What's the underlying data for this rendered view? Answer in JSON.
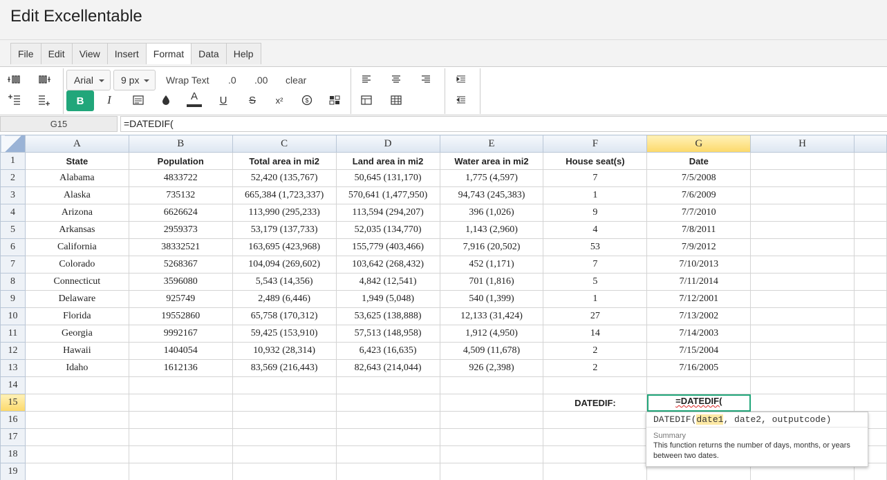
{
  "app": {
    "title": "Edit Excellentable"
  },
  "menu": [
    "File",
    "Edit",
    "View",
    "Insert",
    "Format",
    "Data",
    "Help"
  ],
  "menu_active": "Format",
  "toolbar": {
    "font_family": "Arial",
    "font_size": "9 px",
    "wrap_text": "Wrap Text",
    "dec_decrease": ".0",
    "dec_increase": ".00",
    "clear": "clear",
    "bold": "B",
    "italic": "I",
    "underline": "U",
    "strike": "S",
    "superscript": "x²",
    "font_color": "A",
    "accent_color": "#21a67a"
  },
  "formula_bar": {
    "cell_ref": "G15",
    "formula": "=DATEDIF("
  },
  "sheet": {
    "columns": [
      "A",
      "B",
      "C",
      "D",
      "E",
      "F",
      "G",
      "H"
    ],
    "rows": [
      "1",
      "2",
      "3",
      "4",
      "5",
      "6",
      "7",
      "8",
      "9",
      "10",
      "11",
      "12",
      "13",
      "14",
      "15",
      "16",
      "17",
      "18",
      "19"
    ],
    "header_row": [
      "State",
      "Population",
      "Total area in mi2",
      "Land area in mi2",
      "Water area in mi2",
      "House seat(s)",
      "Date",
      ""
    ],
    "data_rows": [
      [
        "Alabama",
        "4833722",
        "52,420 (135,767)",
        "50,645 (131,170)",
        "1,775 (4,597)",
        "7",
        "7/5/2008",
        ""
      ],
      [
        "Alaska",
        "735132",
        "665,384 (1,723,337)",
        "570,641 (1,477,950)",
        "94,743 (245,383)",
        "1",
        "7/6/2009",
        ""
      ],
      [
        "Arizona",
        "6626624",
        "113,990 (295,233)",
        "113,594 (294,207)",
        "396 (1,026)",
        "9",
        "7/7/2010",
        ""
      ],
      [
        "Arkansas",
        "2959373",
        "53,179 (137,733)",
        "52,035 (134,770)",
        "1,143 (2,960)",
        "4",
        "7/8/2011",
        ""
      ],
      [
        "California",
        "38332521",
        "163,695 (423,968)",
        "155,779 (403,466)",
        "7,916 (20,502)",
        "53",
        "7/9/2012",
        ""
      ],
      [
        "Colorado",
        "5268367",
        "104,094 (269,602)",
        "103,642 (268,432)",
        "452 (1,171)",
        "7",
        "7/10/2013",
        ""
      ],
      [
        "Connecticut",
        "3596080",
        "5,543 (14,356)",
        "4,842 (12,541)",
        "701 (1,816)",
        "5",
        "7/11/2014",
        ""
      ],
      [
        "Delaware",
        "925749",
        "2,489 (6,446)",
        "1,949 (5,048)",
        "540 (1,399)",
        "1",
        "7/12/2001",
        ""
      ],
      [
        "Florida",
        "19552860",
        "65,758 (170,312)",
        "53,625 (138,888)",
        "12,133 (31,424)",
        "27",
        "7/13/2002",
        ""
      ],
      [
        "Georgia",
        "9992167",
        "59,425 (153,910)",
        "57,513 (148,958)",
        "1,912 (4,950)",
        "14",
        "7/14/2003",
        ""
      ],
      [
        "Hawaii",
        "1404054",
        "10,932 (28,314)",
        "6,423 (16,635)",
        "4,509 (11,678)",
        "2",
        "7/15/2004",
        ""
      ],
      [
        "Idaho",
        "1612136",
        "83,569 (216,443)",
        "82,643 (214,044)",
        "926 (2,398)",
        "2",
        "7/16/2005",
        ""
      ]
    ],
    "datedif_label": "DATEDIF:",
    "active_cell_value": "=DATEDIF(",
    "selected_column": "G",
    "selected_row": "15"
  },
  "tooltip": {
    "sig_prefix": "DATEDIF(",
    "sig_param_active": "date1",
    "sig_rest": ", date2, outputcode)",
    "summary_heading": "Summary",
    "summary_text": "This function returns the number of days, months, or years between two dates."
  }
}
